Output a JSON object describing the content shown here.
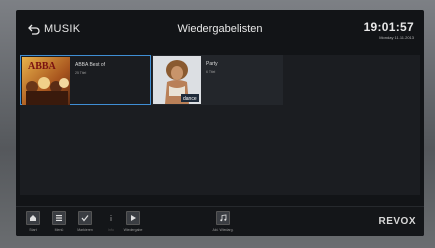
{
  "header": {
    "back_label": "MUSIK",
    "title": "Wiedergabelisten",
    "time": "19:01:57",
    "date": "Monday 11.11.2013"
  },
  "playlists": [
    {
      "name": "ABBA Best of",
      "count": "25 Titel",
      "selected": true,
      "cover_text": "ABBA",
      "cover_icon": "abba-album-cover"
    },
    {
      "name": "Party",
      "count": "6 Titel",
      "selected": false,
      "cover_text": "dance",
      "cover_icon": "party-album-cover"
    }
  ],
  "footer": {
    "buttons": [
      {
        "label": "Start",
        "icon": "home-icon"
      },
      {
        "label": "Menü",
        "icon": "menu-icon"
      },
      {
        "label": "Markieren",
        "icon": "check-icon"
      },
      {
        "label": "Info",
        "icon": "info-icon",
        "disabled": true
      },
      {
        "label": "Wiedergabe",
        "icon": "play-icon"
      },
      {
        "label": "Akt. Wiedarg.",
        "icon": "music-note-icon"
      }
    ],
    "brand": "REVOX"
  },
  "colors": {
    "accent": "#3f8ed4",
    "screen": "#121417"
  }
}
